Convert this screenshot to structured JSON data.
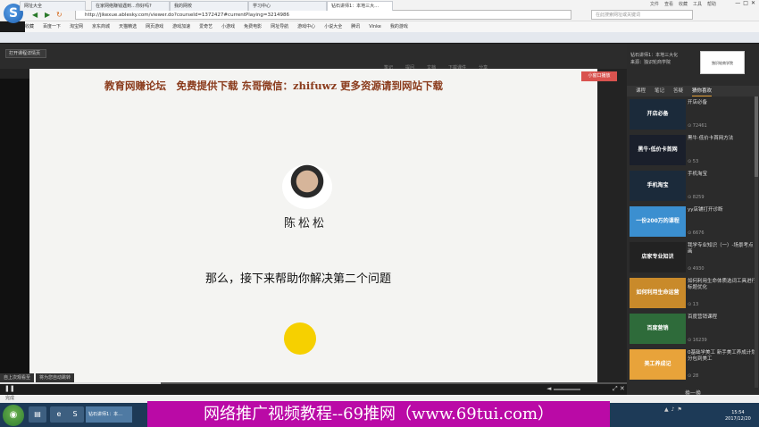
{
  "window": {
    "menu": [
      "文件",
      "查看",
      "收藏",
      "工具",
      "帮助"
    ],
    "controls": [
      "—",
      "□",
      "✕"
    ]
  },
  "navbar": {
    "url": "http://jikexue.ablesky.com/viewer.do?courseId=1372427#currentPlaying=3214986",
    "search_placeholder": "在此搜索网址或关键词"
  },
  "bookmarks": [
    "收藏",
    "百度一下",
    "淘宝网",
    "京东商城",
    "天猫精选",
    "网页游戏",
    "游戏加速",
    "爱奇艺",
    "小游戏",
    "免费电影",
    "网址导航",
    "游戏中心",
    "小说大全",
    "腾讯",
    "Vinke",
    "我的游戏"
  ],
  "tabs": [
    {
      "label": "网址大全"
    },
    {
      "label": "在家网络赚钱遇到…你好吗?"
    },
    {
      "label": "我的网校"
    },
    {
      "label": "学习中心"
    },
    {
      "label": "钻石讲师1：本地三大…"
    }
  ],
  "course": {
    "open_button": "打开课程详情页",
    "tools": [
      "笔记",
      "提问",
      "文档",
      "下载课件",
      "分享"
    ],
    "mini_player": "小窗口播放"
  },
  "video": {
    "banner": "教育网赚论坛　免费提供下载 东哥微信：zhifuwz 更多资源请到网站下载",
    "presenter": "陈松松",
    "subtitle": "那么，接下来帮助你解决第二个问题",
    "tips": [
      "自上次观看至",
      "将为您自动跳转"
    ]
  },
  "right_panel": {
    "header_title": "钻石讲师1：本地三大化",
    "header_source": "来源：独识轮商学院",
    "thumb_label": "独识轮商学院",
    "tabs": [
      "课程",
      "笔记",
      "答疑",
      "猜你喜欢"
    ],
    "active_tab": "猜你喜欢",
    "items": [
      {
        "thumb": "开店必备",
        "title": "开店必备",
        "count": "72461",
        "color": "#1b2a3a"
      },
      {
        "thumb": "黑牛·低价卡首网",
        "title": "黑牛·低价卡首网方法",
        "count": "53",
        "color": "#1a1f2b"
      },
      {
        "thumb": "手机淘宝",
        "title": "手机淘宝",
        "count": "8259",
        "color": "#1b2a3a"
      },
      {
        "thumb": "一份200万的课程",
        "title": "yy店铺打开诊断",
        "count": "6676",
        "color": "#3b8fd0"
      },
      {
        "thumb": "店家专业知识",
        "title": "我学专业知识（一）-场景考点画",
        "count": "4930",
        "color": "#222"
      },
      {
        "thumb": "如何利用生命运营",
        "title": "如何利用生命体质选词工具进行标题优化",
        "count": "13",
        "color": "#c98a2a"
      },
      {
        "thumb": "百度营销",
        "title": "百度营销课程",
        "count": "16239",
        "color": "#2e6b3a"
      },
      {
        "thumb": "美工养成记",
        "title": "0基础学美工 新手美工养成计划 分包到美工",
        "count": "28",
        "color": "#e8a33a"
      }
    ],
    "footer": "换一换"
  },
  "status": {
    "text": "完成"
  },
  "taskbar": {
    "start": "◉",
    "active_window": "钻石讲师1：本…",
    "clock_time": "15:54",
    "clock_date": "2017/12/20"
  },
  "watermark": "网络推广视频教程--69推网（www.69tui.com）"
}
